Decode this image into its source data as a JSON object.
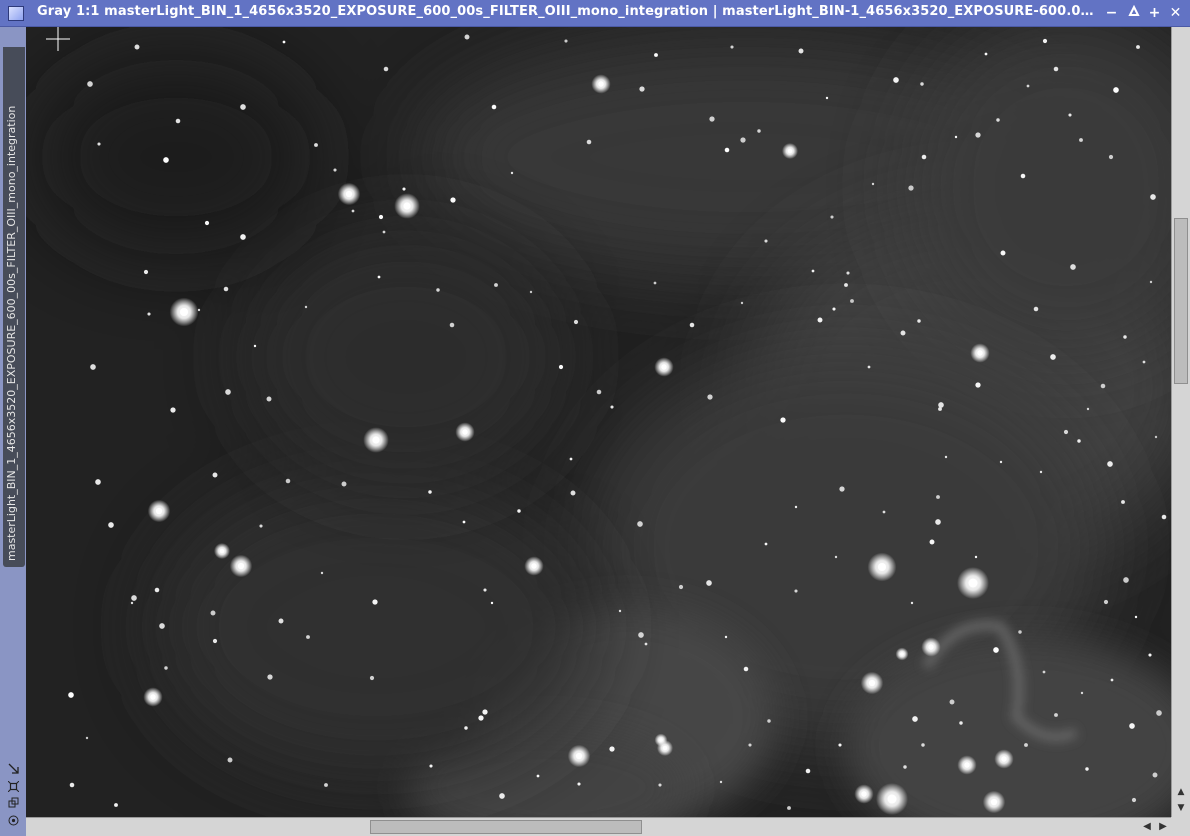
{
  "window": {
    "title": "Gray 1:1 masterLight_BIN_1_4656x3520_EXPOSURE_600_00s_FILTER_OIII_mono_integration | masterLight_BIN-1_4656x3520_EXPOSURE-600.00s_...",
    "side_tab_label": "masterLight_BIN_1_4656x3520_EXPOSURE_600_00s_FILTER_OIII_mono_integration",
    "controls": {
      "minimize": "−",
      "restore": "✖",
      "maximize": "+",
      "close": "✕"
    }
  },
  "icons": {
    "window_icon": "image-window-icon",
    "side_icons": [
      "shrink-icon",
      "fit-icon",
      "clone-icon",
      "target-icon"
    ]
  },
  "image": {
    "description_colors": {
      "background": "#222222",
      "nebula": "#4a4a4a",
      "star": "#ffffff"
    }
  },
  "scrollbars": {
    "vertical": {
      "arrow_up": "▲",
      "arrow_down": "▼"
    },
    "horizontal": {
      "arrow_left": "◀",
      "arrow_right": "▶"
    }
  },
  "colors": {
    "titlebar": "#6273c4",
    "frame": "#6a7ec9",
    "sidetab": "#474c59"
  }
}
